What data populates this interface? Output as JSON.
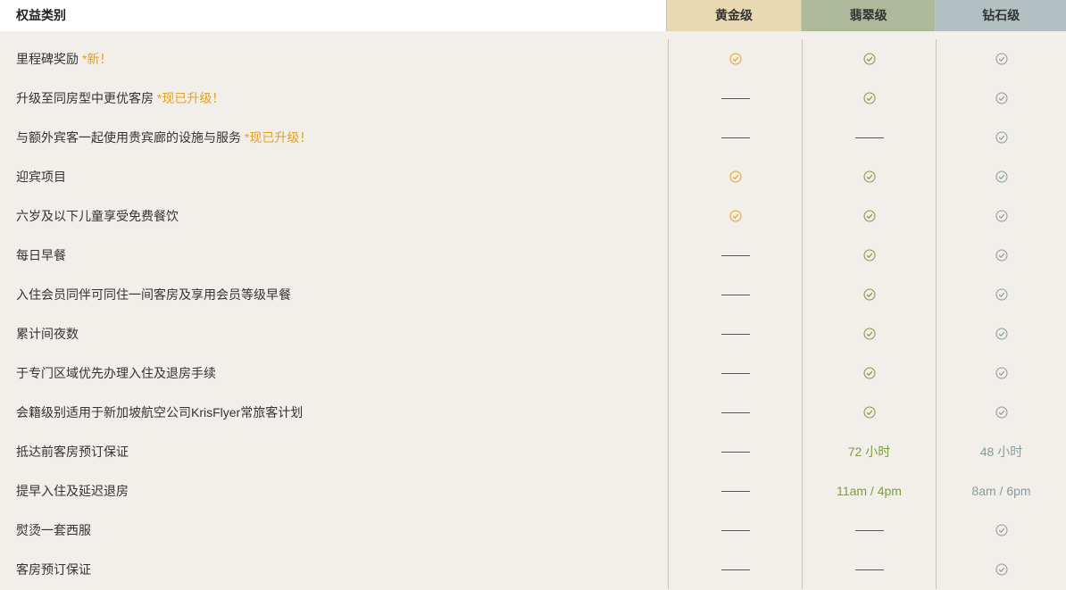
{
  "header": {
    "category_label": "权益类别",
    "tiers": [
      "黄金级",
      "翡翠级",
      "钻石级"
    ]
  },
  "colors": {
    "gold": "#e0a126",
    "emerald": "#7e9a45",
    "diamond": "#8a9a9c",
    "header_gold": "#e8d9b2",
    "header_emerald": "#aeb89a",
    "header_diamond": "#b3c0c2"
  },
  "rows": [
    {
      "label": "里程碑奖励",
      "tag": "*新！",
      "gold": "check",
      "emerald": "check",
      "diamond": "check"
    },
    {
      "label": "升级至同房型中更优客房",
      "tag": "*现已升级！",
      "gold": "dash",
      "emerald": "check",
      "diamond": "check"
    },
    {
      "label": "与额外宾客一起使用贵宾廊的设施与服务",
      "tag": "*现已升级！",
      "gold": "dash",
      "emerald": "dash",
      "diamond": "check"
    },
    {
      "label": "迎宾项目",
      "tag": "",
      "gold": "check",
      "emerald": "check",
      "diamond": "check"
    },
    {
      "label": "六岁及以下儿童享受免费餐饮",
      "tag": "",
      "gold": "check",
      "emerald": "check",
      "diamond": "check"
    },
    {
      "label": "每日早餐",
      "tag": "",
      "gold": "dash",
      "emerald": "check",
      "diamond": "check"
    },
    {
      "label": "入住会员同伴可同住一间客房及享用会员等级早餐",
      "tag": "",
      "gold": "dash",
      "emerald": "check",
      "diamond": "check"
    },
    {
      "label": "累计间夜数",
      "tag": "",
      "gold": "dash",
      "emerald": "check",
      "diamond": "check"
    },
    {
      "label": "于专门区域优先办理入住及退房手续",
      "tag": "",
      "gold": "dash",
      "emerald": "check",
      "diamond": "check"
    },
    {
      "label": "会籍级别适用于新加坡航空公司KrisFlyer常旅客计划",
      "tag": "",
      "gold": "dash",
      "emerald": "check",
      "diamond": "check"
    },
    {
      "label": "抵达前客房预订保证",
      "tag": "",
      "gold": "dash",
      "emerald": "72 小时",
      "diamond": "48 小时"
    },
    {
      "label": "提早入住及延迟退房",
      "tag": "",
      "gold": "dash",
      "emerald": "11am / 4pm",
      "diamond": "8am / 6pm"
    },
    {
      "label": "熨烫一套西服",
      "tag": "",
      "gold": "dash",
      "emerald": "dash",
      "diamond": "check"
    },
    {
      "label": "客房预订保证",
      "tag": "",
      "gold": "dash",
      "emerald": "dash",
      "diamond": "check"
    }
  ]
}
